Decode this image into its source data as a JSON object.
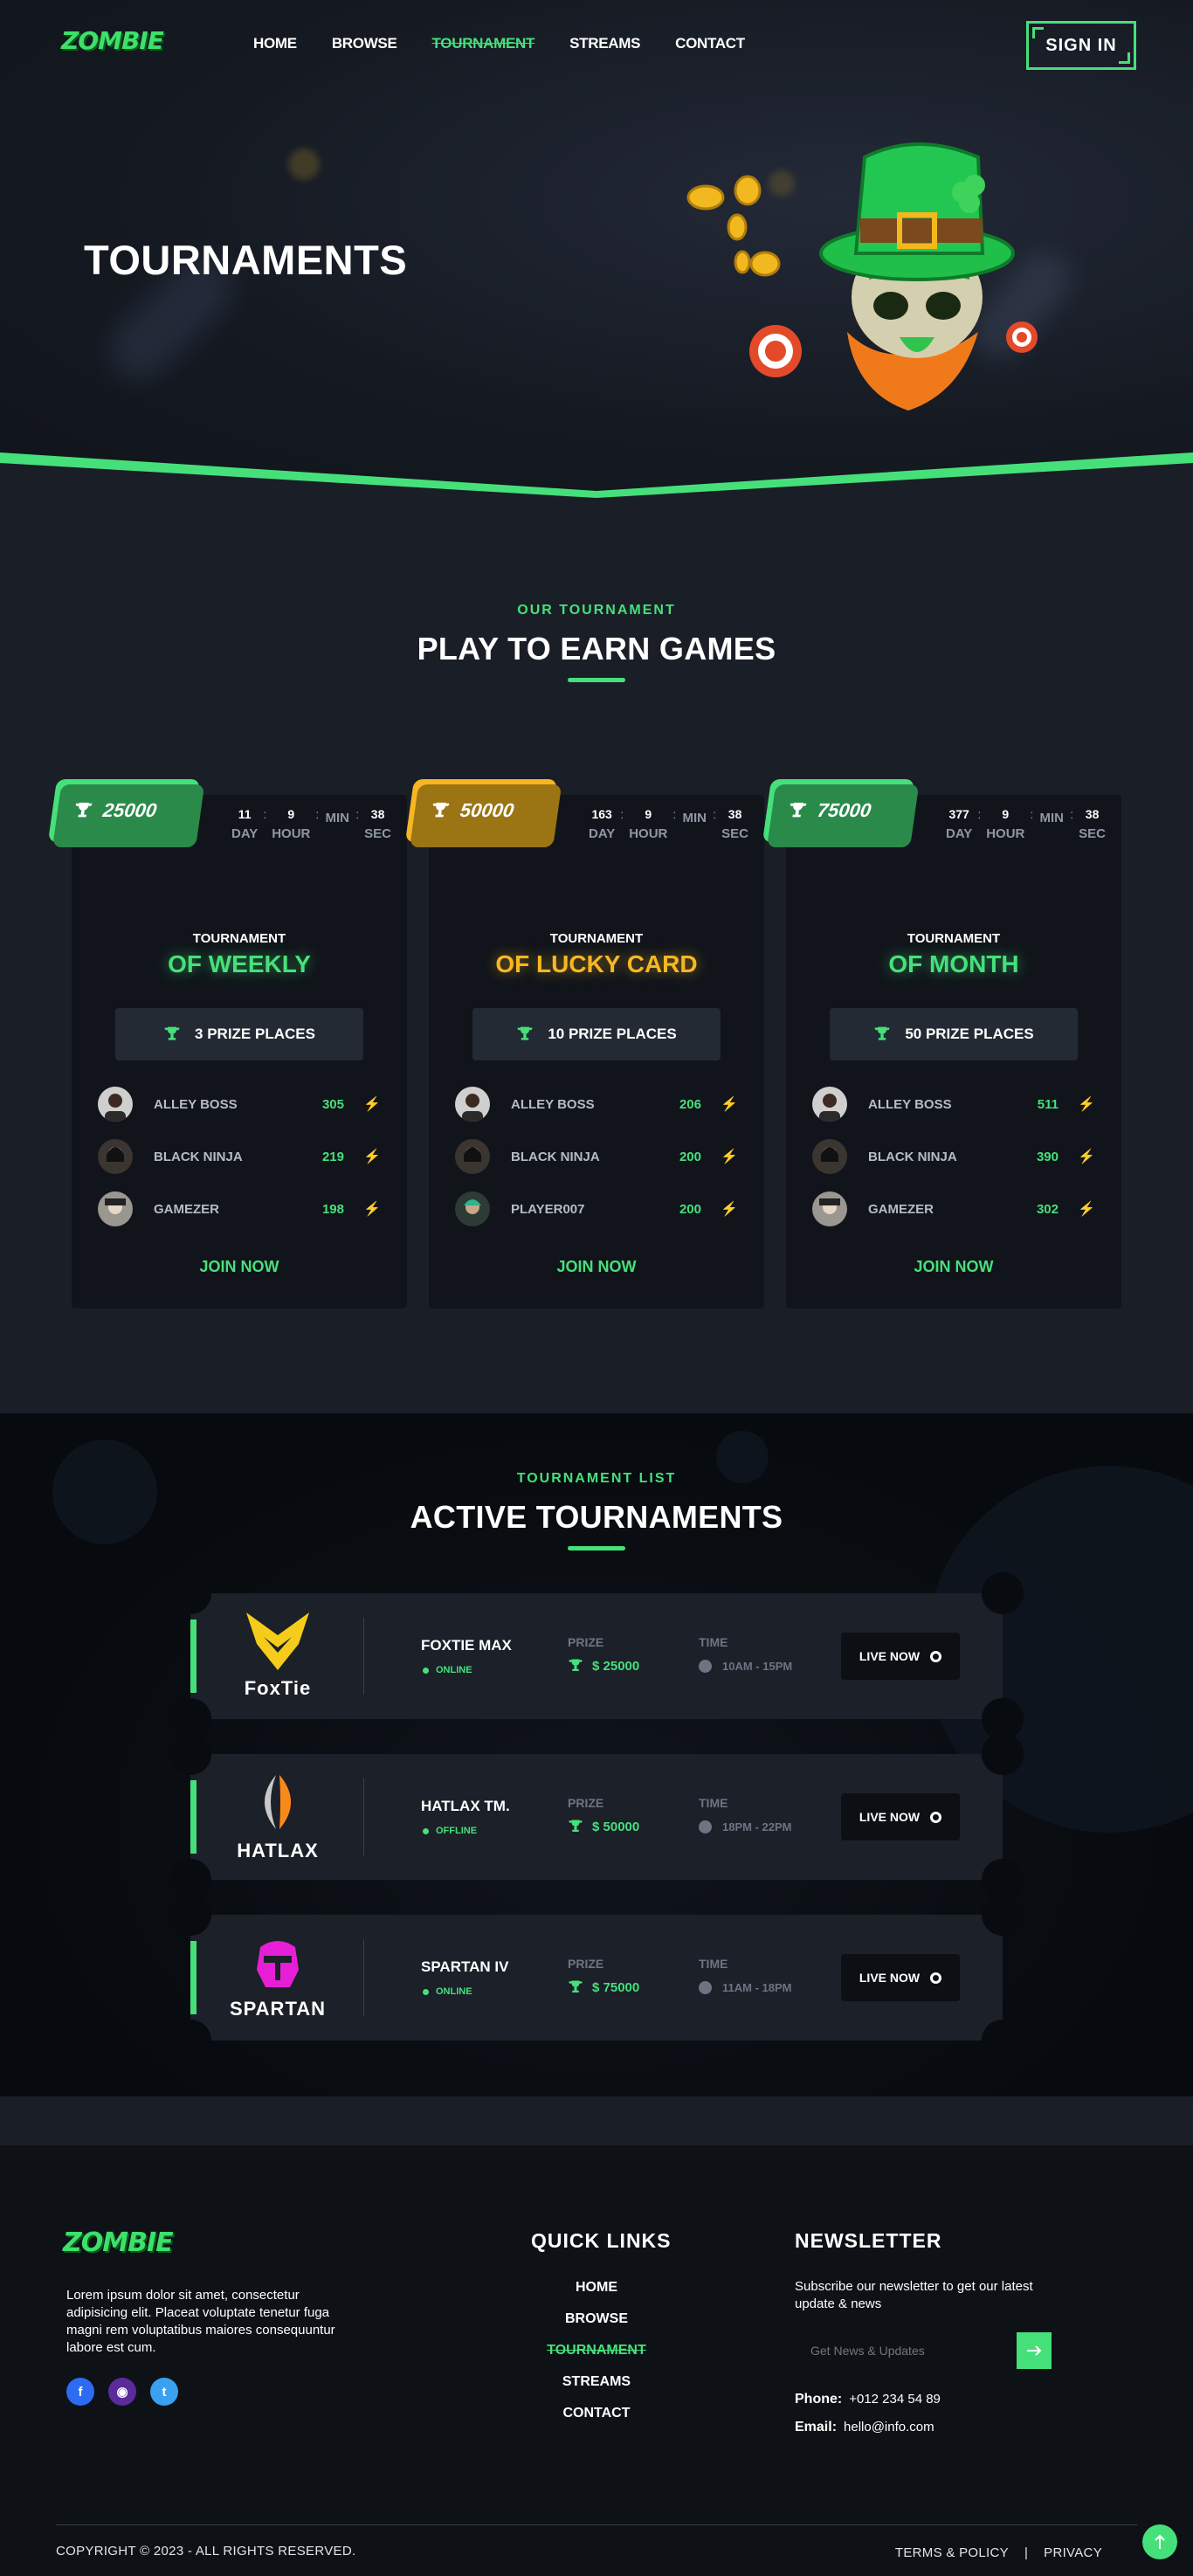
{
  "brand": {
    "logo_text": "ZOMBIE",
    "accent": "#46e07a",
    "accent2": "#f7b722"
  },
  "nav": {
    "items": [
      {
        "label": "HOME"
      },
      {
        "label": "BROWSE"
      },
      {
        "label": "TOURNAMENT"
      },
      {
        "label": "STREAMS"
      },
      {
        "label": "CONTACT"
      }
    ],
    "active": "TOURNAMENT",
    "signin_label": "SIGN IN"
  },
  "hero": {
    "title": "TOURNAMENTS"
  },
  "our_tournament": {
    "kicker": "OUR TOURNAMENT",
    "title": "PLAY TO EARN GAMES",
    "cards": [
      {
        "prize": "25000",
        "timer": {
          "day": "11",
          "hour": "9",
          "min_label": "MIN",
          "sec": "38",
          "day_label": "DAY",
          "hour_label": "HOUR",
          "sec_label": "SEC"
        },
        "kicker": "TOURNAMENT",
        "name": "OF WEEKLY",
        "places": "3 PRIZE PLACES",
        "players": [
          {
            "name": "ALLEY BOSS",
            "score": "305"
          },
          {
            "name": "BLACK NINJA",
            "score": "219"
          },
          {
            "name": "GAMEZER",
            "score": "198"
          }
        ],
        "join": "JOIN NOW"
      },
      {
        "prize": "50000",
        "timer": {
          "day": "163",
          "hour": "9",
          "min_label": "MIN",
          "sec": "38",
          "day_label": "DAY",
          "hour_label": "HOUR",
          "sec_label": "SEC"
        },
        "kicker": "TOURNAMENT",
        "name": "OF LUCKY CARD",
        "places": "10 PRIZE PLACES",
        "players": [
          {
            "name": "ALLEY BOSS",
            "score": "206"
          },
          {
            "name": "BLACK NINJA",
            "score": "200"
          },
          {
            "name": "PLAYER007",
            "score": "200"
          }
        ],
        "join": "JOIN NOW"
      },
      {
        "prize": "75000",
        "timer": {
          "day": "377",
          "hour": "9",
          "min_label": "MIN",
          "sec": "38",
          "day_label": "DAY",
          "hour_label": "HOUR",
          "sec_label": "SEC"
        },
        "kicker": "TOURNAMENT",
        "name": "OF MONTH",
        "places": "50 PRIZE PLACES",
        "players": [
          {
            "name": "ALLEY BOSS",
            "score": "511"
          },
          {
            "name": "BLACK NINJA",
            "score": "390"
          },
          {
            "name": "GAMEZER",
            "score": "302"
          }
        ],
        "join": "JOIN NOW"
      }
    ]
  },
  "active": {
    "kicker": "TOURNAMENT LIST",
    "title": "ACTIVE TOURNAMENTS",
    "rows": [
      {
        "brand": "FoxTie",
        "name": "FOXTIE MAX",
        "status": "ONLINE",
        "prize_label": "PRIZE",
        "prize": "$ 25000",
        "time_label": "TIME",
        "time": "10AM - 15PM",
        "button": "LIVE NOW"
      },
      {
        "brand": "HATLAX",
        "name": "HATLAX TM.",
        "status": "OFFLINE",
        "prize_label": "PRIZE",
        "prize": "$ 50000",
        "time_label": "TIME",
        "time": "18PM - 22PM",
        "button": "LIVE NOW"
      },
      {
        "brand": "SPARTAN",
        "name": "SPARTAN IV",
        "status": "ONLINE",
        "prize_label": "PRIZE",
        "prize": "$ 75000",
        "time_label": "TIME",
        "time": "11AM - 18PM",
        "button": "LIVE NOW"
      }
    ]
  },
  "footer": {
    "about": "Lorem ipsum dolor sit amet, consectetur adipisicing elit. Placeat voluptate tenetur fuga magni rem voluptatibus maiores consequuntur labore est cum.",
    "socials": [
      "facebook-icon",
      "discord-icon",
      "twitter-icon"
    ],
    "quick_links_title": "QUICK LINKS",
    "quick_links": [
      "HOME",
      "BROWSE",
      "TOURNAMENT",
      "STREAMS",
      "CONTACT"
    ],
    "newsletter_title": "NEWSLETTER",
    "newsletter_text": "Subscribe our newsletter to get our latest update & news",
    "newsletter_placeholder": "Get News & Updates",
    "phone_label": "Phone:",
    "phone": "+012 234 54 89",
    "email_label": "Email:",
    "email": "hello@info.com",
    "copyright": "COPYRIGHT © 2023 - ALL RIGHTS RESERVED.",
    "terms": "TERMS & POLICY",
    "separator": "|",
    "privacy": "PRIVACY"
  }
}
